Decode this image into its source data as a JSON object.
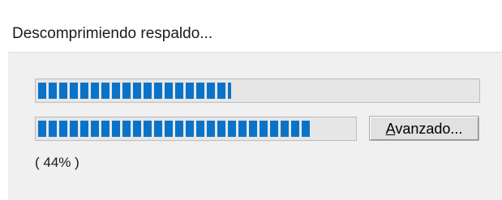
{
  "dialog": {
    "title": "Descomprimiendo respaldo..."
  },
  "progress": {
    "primary_fraction": 0.44,
    "secondary_fraction": 0.87
  },
  "advanced_button": {
    "accel": "A",
    "rest": "vanzado..."
  },
  "status": {
    "percent_text": "( 44% )"
  },
  "colors": {
    "progress_fill": "#0a73c9",
    "panel_background": "#f0f0f0"
  }
}
